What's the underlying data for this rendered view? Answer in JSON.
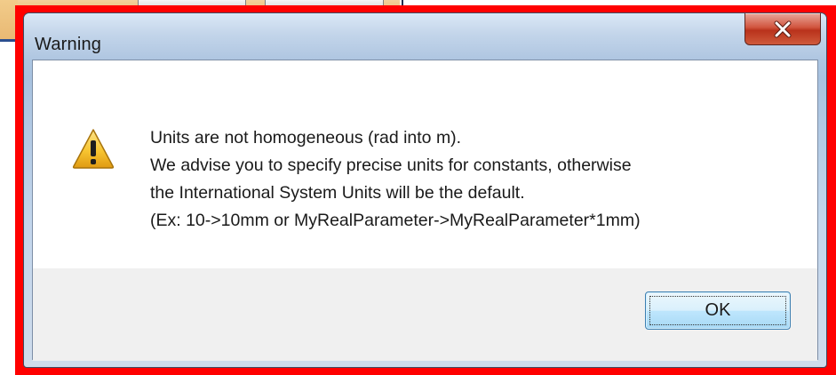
{
  "dialog": {
    "title": "Warning",
    "close_icon": "close-icon",
    "warning_icon": "warning-icon",
    "message_lines": [
      "Units are not homogeneous (rad into m).",
      "We advise you to specify precise units for constants, otherwise",
      "the International System Units will be the default.",
      "(Ex: 10->10mm or MyRealParameter->MyRealParameter*1mm)"
    ],
    "ok_label": "OK"
  },
  "colors": {
    "highlight_frame": "#ff0000",
    "close_button": "#c8442b",
    "warning_icon_fill": "#f7c531",
    "ok_button_border": "#3c7fb1"
  }
}
